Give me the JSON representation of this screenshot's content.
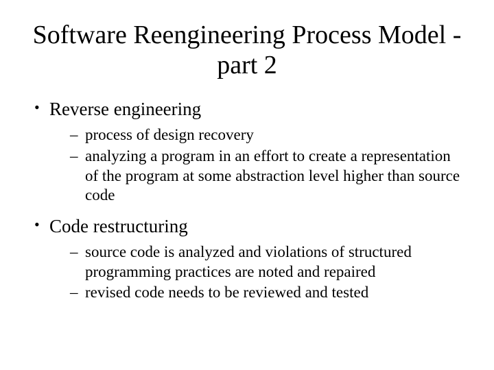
{
  "title": "Software Reengineering Process Model - part 2",
  "bullets": [
    {
      "text": "Reverse engineering",
      "sub": [
        "process of design recovery",
        "analyzing a program in an effort to create a representation of the program at some abstraction level higher than source code"
      ]
    },
    {
      "text": "Code restructuring",
      "sub": [
        "source code is analyzed and violations of structured programming practices are noted and repaired",
        "revised code needs to be reviewed and tested"
      ]
    }
  ]
}
